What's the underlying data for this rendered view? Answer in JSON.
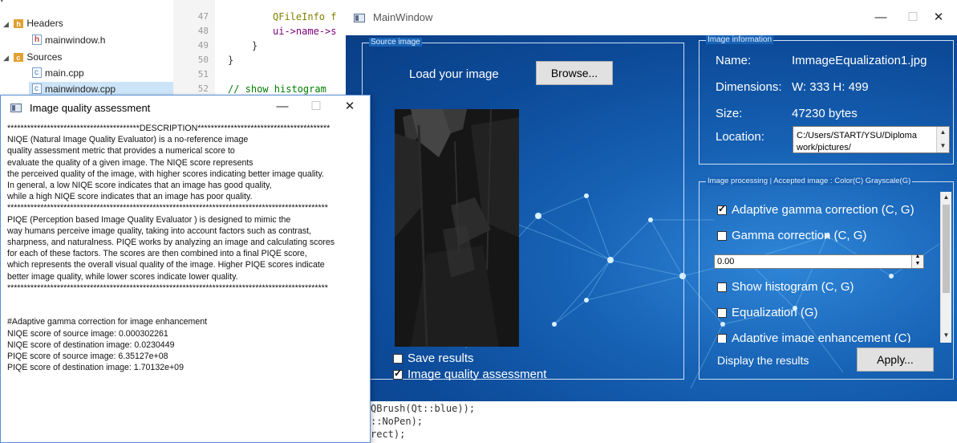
{
  "ide": {
    "tree": [
      {
        "label": "Headers",
        "kind": "folder-h",
        "expanded": true
      },
      {
        "label": "mainwindow.h",
        "kind": "file-h"
      },
      {
        "label": "Sources",
        "kind": "folder-c",
        "expanded": true
      },
      {
        "label": "main.cpp",
        "kind": "file-c"
      },
      {
        "label": "mainwindow.cpp",
        "kind": "file-c",
        "selected": true
      }
    ],
    "line_numbers": [
      "47",
      "48",
      "49",
      "50",
      "51",
      "52"
    ],
    "code_lines": [
      {
        "text": "QFileInfo f",
        "style": "kw"
      },
      {
        "text": "ui->name->s",
        "style": "pu"
      },
      {
        "text": "}",
        "style": "plain"
      },
      {
        "text": "}",
        "style": "plain"
      },
      {
        "text": "",
        "style": "plain"
      },
      {
        "text": "// show histogram",
        "style": "cm"
      }
    ],
    "code_bottom_lines": [
      "QBrush(Qt::blue));",
      "::NoPen);",
      "rect);"
    ]
  },
  "iqa_window": {
    "title": "Image quality assessment",
    "minimize": "—",
    "maximize": "☐",
    "close": "✕",
    "text": "****************************************DESCRIPTION****************************************\nNIQE (Natural Image Quality Evaluator) is a no-reference image\nquality assessment metric that provides a numerical score to\nevaluate the quality of a given image. The NIQE score represents\nthe perceived quality of the image, with higher scores indicating better image quality.\nIn general, a low NIQE score indicates that an image has good quality,\nwhile a high NIQE score indicates that an image has poor quality.\n*************************************************************************************************\nPIQE (Perception based Image Quality Evaluator ) is designed to mimic the\nway humans perceive image quality, taking into account factors such as contrast,\nsharpness, and naturalness. PIQE works by analyzing an image and calculating scores\nfor each of these factors. The scores are then combined into a final PIQE score,\nwhich represents the overall visual quality of the image. Higher PIQE scores indicate\nbetter image quality, while lower scores indicate lower quality.\n*************************************************************************************************\n\n\n#Adaptive gamma correction for image enhancement\nNIQE score of source image: 0.000302261\nNIQE score of destination image: 0.0230449\nPIQE score of source image: 6.35127e+08\nPIQE score of destination image: 1.70132e+09"
  },
  "main_window": {
    "title": "MainWindow",
    "minimize": "—",
    "maximize": "☐",
    "close": "✕",
    "source_group": {
      "title": "Source image",
      "load_label": "Load your image",
      "browse_button": "Browse...",
      "save_results": {
        "label": "Save results",
        "checked": false
      },
      "quality_assessment": {
        "label": "Image quality assessment",
        "checked": true
      }
    },
    "info_group": {
      "title": "Image information",
      "name_label": "Name:",
      "name_value": "ImmageEqualization1.jpg",
      "dimensions_label": "Dimensions:",
      "dimensions_value": "W: 333 H: 499",
      "size_label": "Size:",
      "size_value": "47230 bytes",
      "location_label": "Location:",
      "location_value": "C:/Users/START/YSU/Diploma work/pictures/"
    },
    "processing_group": {
      "title": "Image processing | Accepted image : Color(C) Grayscale(G)",
      "options": [
        {
          "label": "Adaptive gamma correction (C, G)",
          "checked": true
        },
        {
          "label": "Gamma correction (C, G)",
          "checked": false
        },
        {
          "label": "Show histogram (C, G)",
          "checked": false
        },
        {
          "label": "Equalization (G)",
          "checked": false
        },
        {
          "label": "Adaptive image enhancement (C)",
          "checked": false
        }
      ],
      "gamma_value": "0.00",
      "display_label": "Display the results",
      "apply_button": "Apply..."
    }
  }
}
